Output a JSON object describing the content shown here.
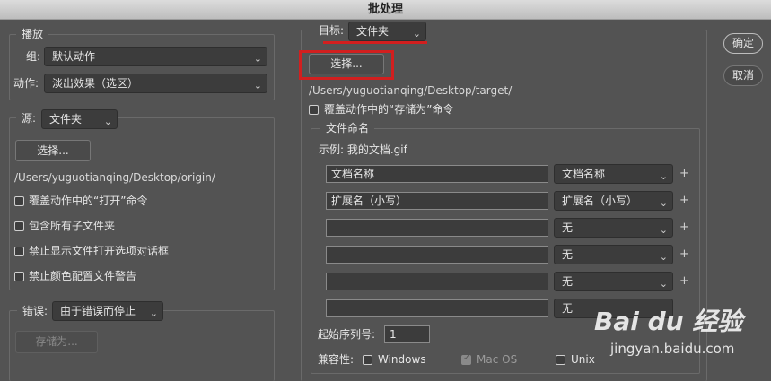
{
  "window": {
    "title": "批处理"
  },
  "play": {
    "legend": "播放",
    "group_label": "组:",
    "group_value": "默认动作",
    "action_label": "动作:",
    "action_value": "淡出效果（选区）"
  },
  "source": {
    "label": "源:",
    "value": "文件夹",
    "choose_button": "选择...",
    "path": "/Users/yuguotianqing/Desktop/origin/",
    "checkboxes": [
      {
        "label": "覆盖动作中的“打开”命令"
      },
      {
        "label": "包含所有子文件夹"
      },
      {
        "label": "禁止显示文件打开选项对话框"
      },
      {
        "label": "禁止颜色配置文件警告"
      }
    ]
  },
  "errors": {
    "label": "错误:",
    "value": "由于错误而停止",
    "save_as_button": "存储为..."
  },
  "destination": {
    "label": "目标:",
    "value": "文件夹",
    "choose_button": "选择...",
    "path": "/Users/yuguotianqing/Desktop/target/",
    "override_label": "覆盖动作中的“存储为”命令"
  },
  "file_naming": {
    "legend": "文件命名",
    "example": "示例: 我的文档.gif",
    "rows": [
      {
        "text": "文档名称",
        "select": "文档名称",
        "plus": "+"
      },
      {
        "text": "扩展名（小写）",
        "select": "扩展名（小写）",
        "plus": "+"
      },
      {
        "text": "",
        "select": "无",
        "plus": "+"
      },
      {
        "text": "",
        "select": "无",
        "plus": "+"
      },
      {
        "text": "",
        "select": "无",
        "plus": "+"
      },
      {
        "text": "",
        "select": "无",
        "plus": ""
      }
    ],
    "serial_label": "起始序列号:",
    "serial_value": "1",
    "compat_label": "兼容性:",
    "compat_windows": "Windows",
    "compat_macos": "Mac OS",
    "compat_unix": "Unix"
  },
  "buttons": {
    "ok": "确定",
    "cancel": "取消"
  },
  "watermark": {
    "brand": "Bai du 经验",
    "url": "jingyan.baidu.com"
  },
  "icons": {
    "chevron": "chevron-down-icon"
  },
  "colors": {
    "highlight": "#d21f1f",
    "background": "#535353"
  }
}
